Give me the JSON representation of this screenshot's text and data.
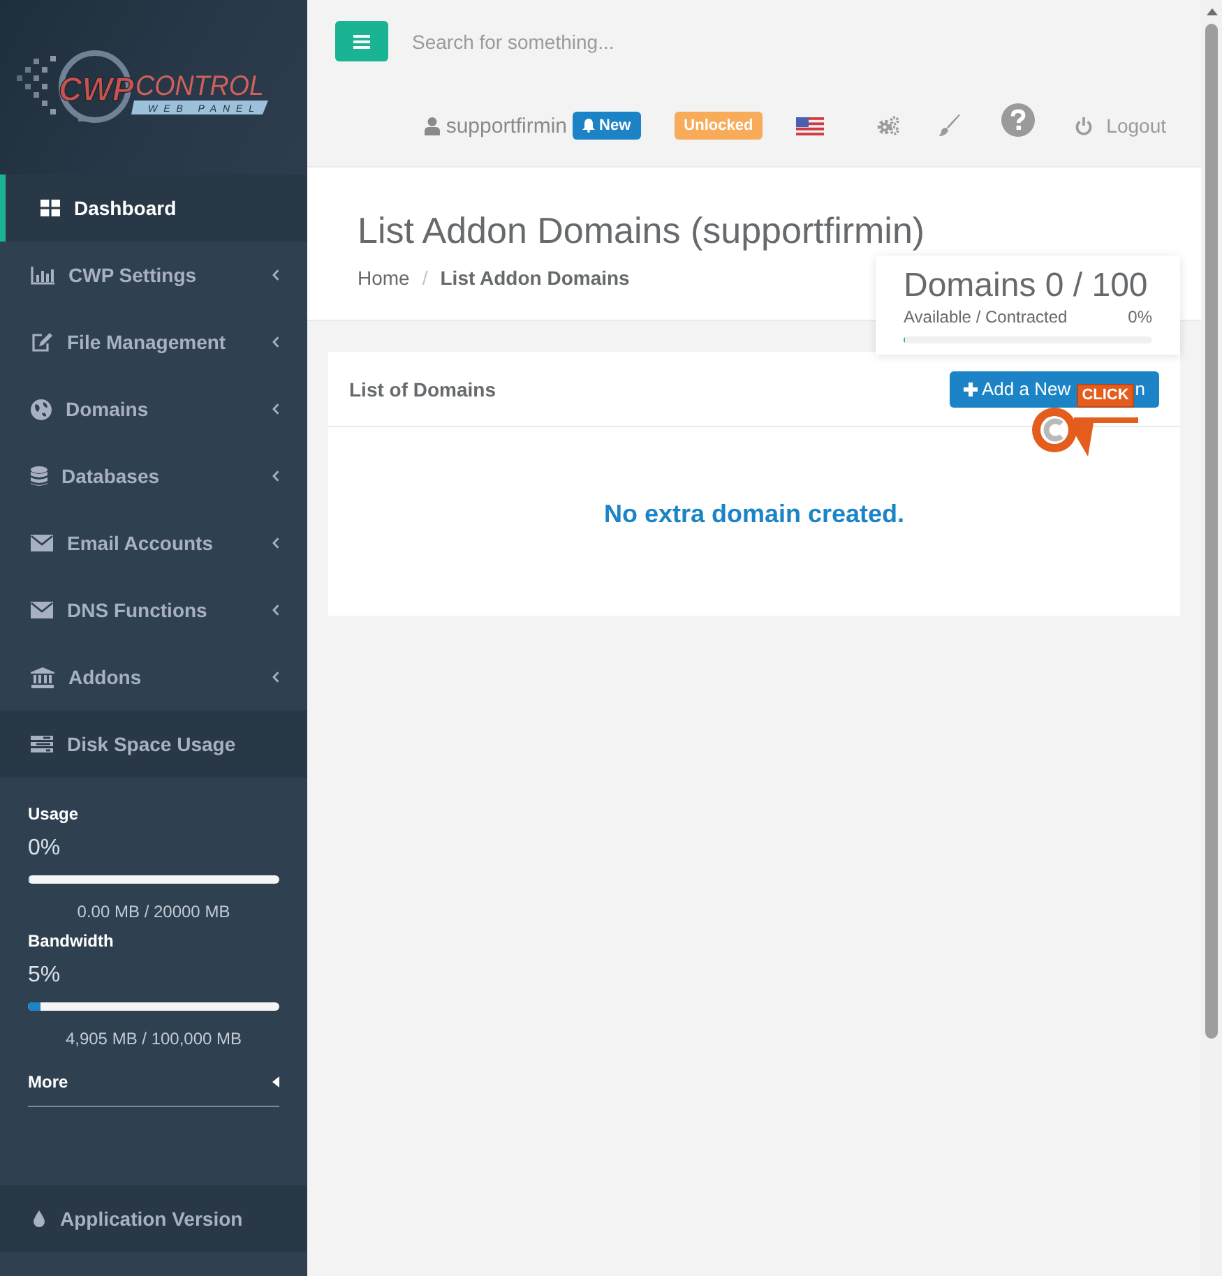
{
  "sidebar": {
    "logo": {
      "name": "CWP",
      "product": "CONTROL",
      "tagline": "WEB PANEL"
    },
    "menu": [
      {
        "label": "Dashboard",
        "selected": true,
        "expandable": false
      },
      {
        "label": "CWP Settings",
        "selected": false,
        "expandable": true
      },
      {
        "label": "File Management",
        "selected": false,
        "expandable": true
      },
      {
        "label": "Domains",
        "selected": false,
        "expandable": true
      },
      {
        "label": "Databases",
        "selected": false,
        "expandable": true
      },
      {
        "label": "Email Accounts",
        "selected": false,
        "expandable": true
      },
      {
        "label": "DNS Functions",
        "selected": false,
        "expandable": true
      },
      {
        "label": "Addons",
        "selected": false,
        "expandable": true
      }
    ],
    "disk_usage": {
      "label": "Disk Space Usage",
      "stats": [
        {
          "label": "Usage",
          "percent": "0%",
          "level": 0,
          "reading": "0.00 MB / 20000 MB"
        },
        {
          "label": "Bandwidth",
          "percent": "5%",
          "level": 0.05,
          "reading": "4,905 MB / 100,000 MB"
        }
      ],
      "more": "More"
    },
    "footer": "Application Version"
  },
  "topbar": {
    "search": {
      "placeholder": "Search for something..."
    },
    "user": "supportfirmin",
    "notification": "New",
    "license": "Unlocked",
    "logout": "Logout"
  },
  "page": {
    "title": "List Addon Domains (supportfirmin)",
    "breadcrumb": {
      "separator": "/",
      "items": [
        {
          "label": "Home",
          "current": false
        },
        {
          "label": "List Addon Domains",
          "current": true
        }
      ]
    }
  },
  "domains_summary": {
    "title": "Domains 0 / 100",
    "caption": "Available / Contracted",
    "percent": "0%",
    "level": 0
  },
  "panel": {
    "title": "List of Domains",
    "add_button": {
      "label_start": "Add a New",
      "label_end": "n"
    },
    "empty_message": "No extra domain created."
  },
  "callout": {
    "label": "CLICK"
  }
}
